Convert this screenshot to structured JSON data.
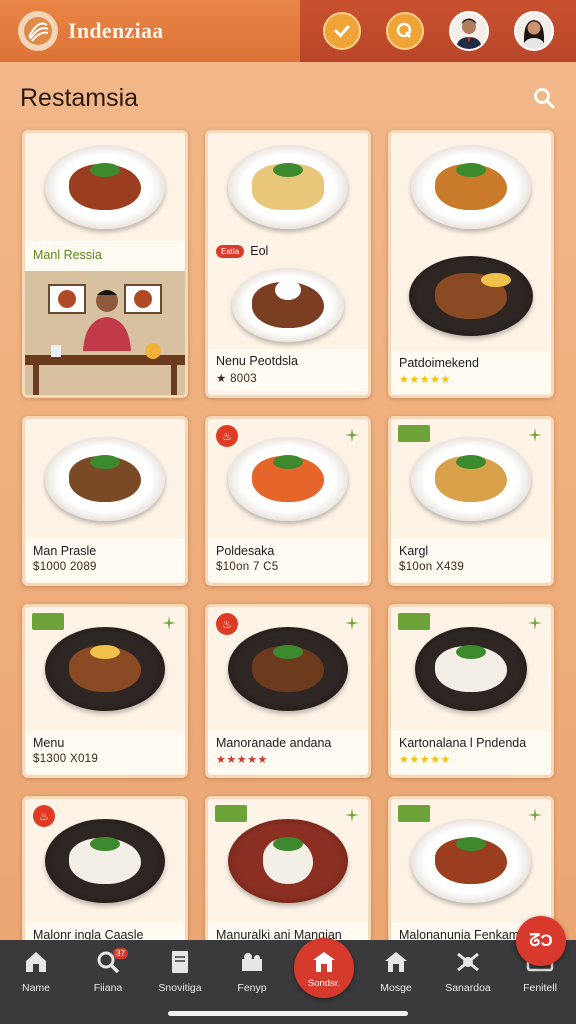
{
  "header": {
    "app_title": "Indenziaa",
    "logo_icon": "leaf-logo-icon",
    "check_icon": "check-icon",
    "search_icon": "search-icon",
    "avatars": [
      "avatar-man",
      "avatar-woman"
    ]
  },
  "page": {
    "heading": "Restamsia",
    "search_icon": "search-icon"
  },
  "cards": [
    {
      "title": "Manl Ressia",
      "sub": "",
      "rating": "",
      "badge": "",
      "special": "video"
    },
    {
      "title": "Nenu Peotdsla",
      "sub": "★ 8003",
      "rating": "",
      "badge": "tag",
      "tag_text": "Eatia",
      "tag_title": "Eol"
    },
    {
      "title": "Patdoimekend",
      "sub": "",
      "rating": "★★★★★",
      "badge": ""
    },
    {
      "title": "Man Prasle",
      "sub": "$1000 2089",
      "rating": "",
      "badge": ""
    },
    {
      "title": "Poldesaka",
      "sub": "$10on 7 C5",
      "rating": "",
      "badge": "red"
    },
    {
      "title": "Kargl",
      "sub": "$10on X439",
      "rating": "",
      "badge": "green"
    },
    {
      "title": "Menu",
      "sub": "$1300 X019",
      "rating": "",
      "badge": "green"
    },
    {
      "title": "Manoranade andana",
      "sub": "",
      "rating": "★★★★★",
      "rating_color": "red",
      "badge": "red"
    },
    {
      "title": "Kartonalana l Pndenda",
      "sub": "",
      "rating": "★★★★★",
      "badge": "green"
    },
    {
      "title": "Malonr ingla Caasle",
      "sub": "",
      "rating": "",
      "badge": "red"
    },
    {
      "title": "Manuralki ani Mangian",
      "sub": "",
      "rating": "",
      "badge": "green"
    },
    {
      "title": "Malonanunia Fenkam",
      "sub": "",
      "rating": "",
      "badge": "green"
    }
  ],
  "nav": [
    {
      "label": "Name",
      "icon": "home-icon"
    },
    {
      "label": "Fiiana",
      "icon": "search-icon",
      "badge": "37"
    },
    {
      "label": "Snovitiga",
      "icon": "document-icon"
    },
    {
      "label": "Fenyp",
      "icon": "puzzle-icon"
    },
    {
      "label": "Sondsr.",
      "icon": "store-icon",
      "active": true
    },
    {
      "label": "Mosge",
      "icon": "house-icon"
    },
    {
      "label": "Sanardoa",
      "icon": "robot-icon"
    },
    {
      "label": "Fenitell",
      "icon": "keyboard-icon"
    }
  ],
  "fab": {
    "label": "ᘔϽ"
  },
  "colors": {
    "accent": "#d53a2c",
    "header_left": "#e98546",
    "header_right": "#c8512e",
    "nav_bg": "#3a3a3c"
  }
}
